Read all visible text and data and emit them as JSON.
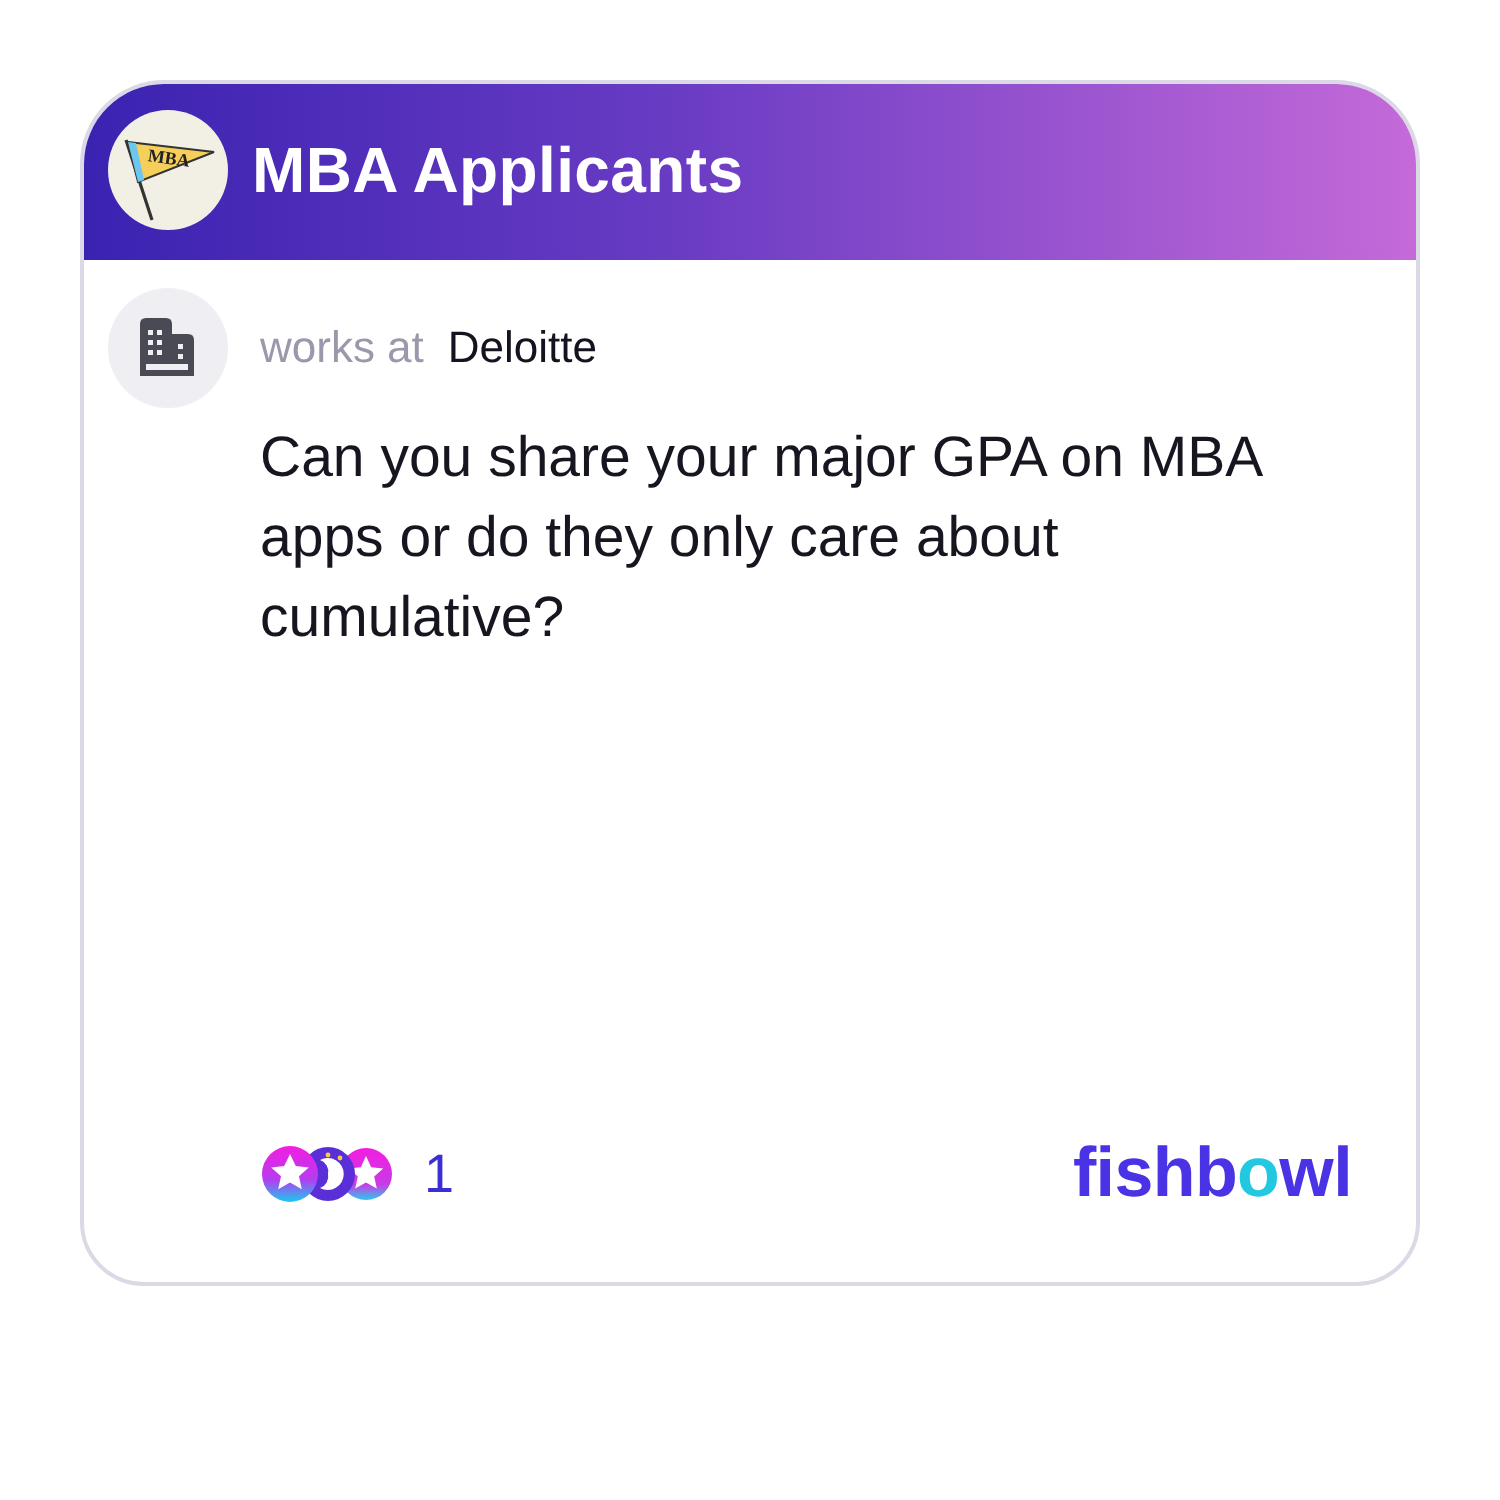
{
  "group": {
    "name": "MBA Applicants",
    "avatar_text": "MBA"
  },
  "post": {
    "author_prefix": "works at",
    "employer": "Deloitte",
    "question": "Can you share your major GPA on MBA apps or do they only care about cumulative?"
  },
  "footer": {
    "reaction_count": "1",
    "brand": "fishbowl"
  }
}
